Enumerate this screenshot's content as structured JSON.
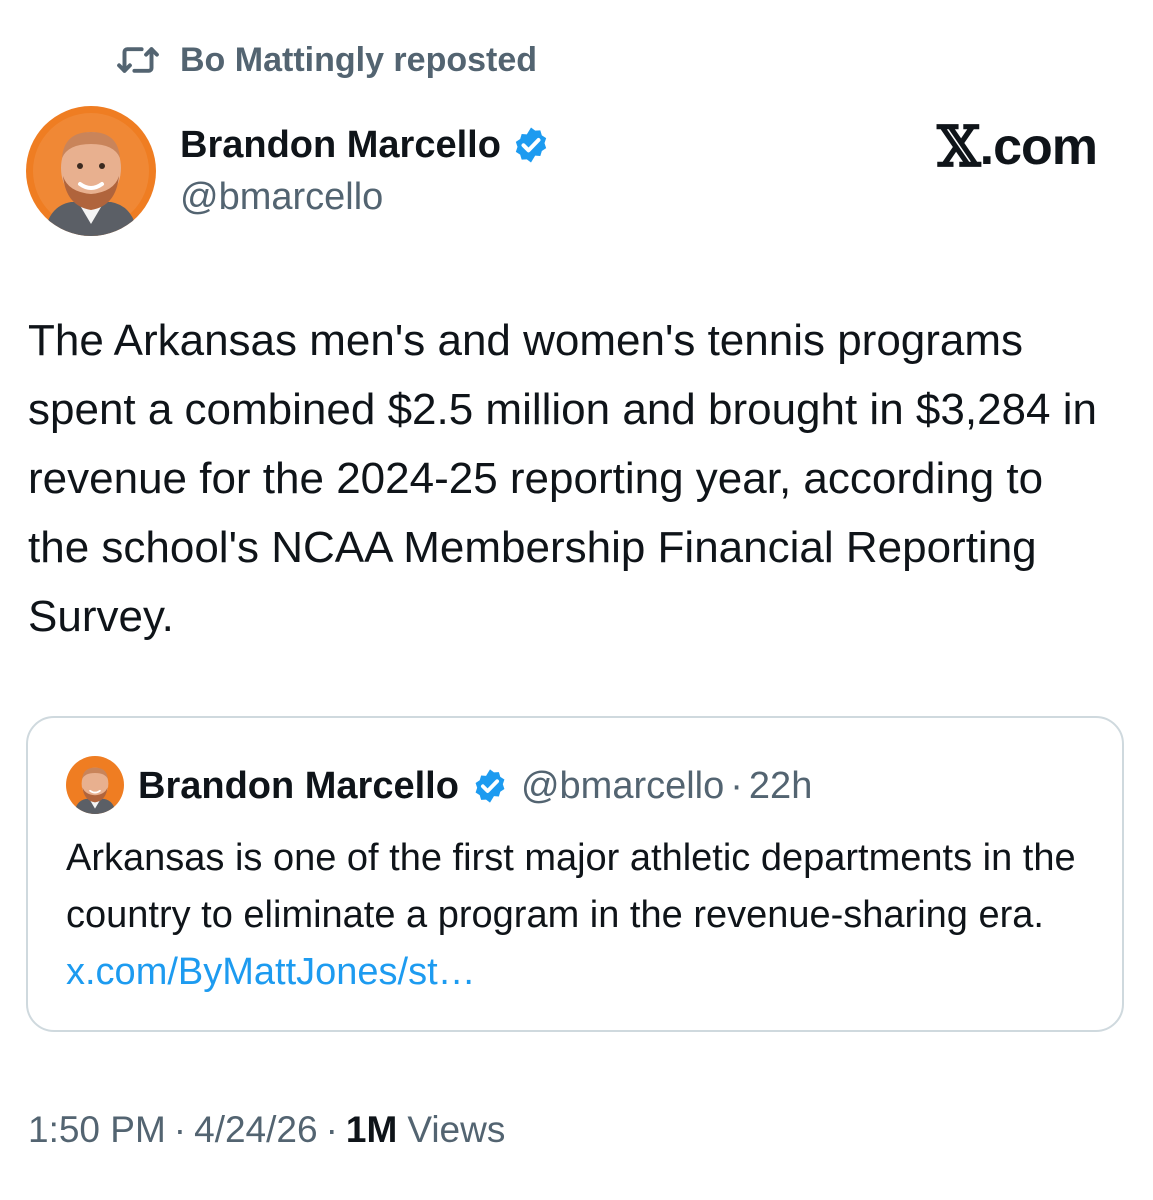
{
  "repost": {
    "icon": "repost-icon",
    "text": "Bo Mattingly reposted"
  },
  "brand": {
    "x_glyph": "𝕏",
    "suffix": ".com"
  },
  "tweet": {
    "author_name": "Brandon Marcello",
    "author_handle": "@bmarcello",
    "verified_color": "#1d9bf0",
    "body": "The Arkansas men's and women's tennis programs spent a combined $2.5 million and brought in $3,284 in revenue for the 2024-25 reporting year, according to the school's NCAA Membership Financial Reporting Survey."
  },
  "quote": {
    "author_name": "Brandon Marcello",
    "author_handle": "@bmarcello",
    "separator": "·",
    "time": "22h",
    "text": "Arkansas is one of the first major athletic departments in the country to eliminate a program in the revenue-sharing era.",
    "link": "x.com/ByMattJones/st…"
  },
  "meta": {
    "time": "1:50 PM",
    "separator": "·",
    "date": "4/24/26",
    "views_count": "1M",
    "views_label": "Views"
  },
  "colors": {
    "text_primary": "#0f1419",
    "text_secondary": "#536471",
    "link": "#1d9bf0",
    "border": "#cfd9de",
    "avatar_background": "#ef7d22"
  }
}
